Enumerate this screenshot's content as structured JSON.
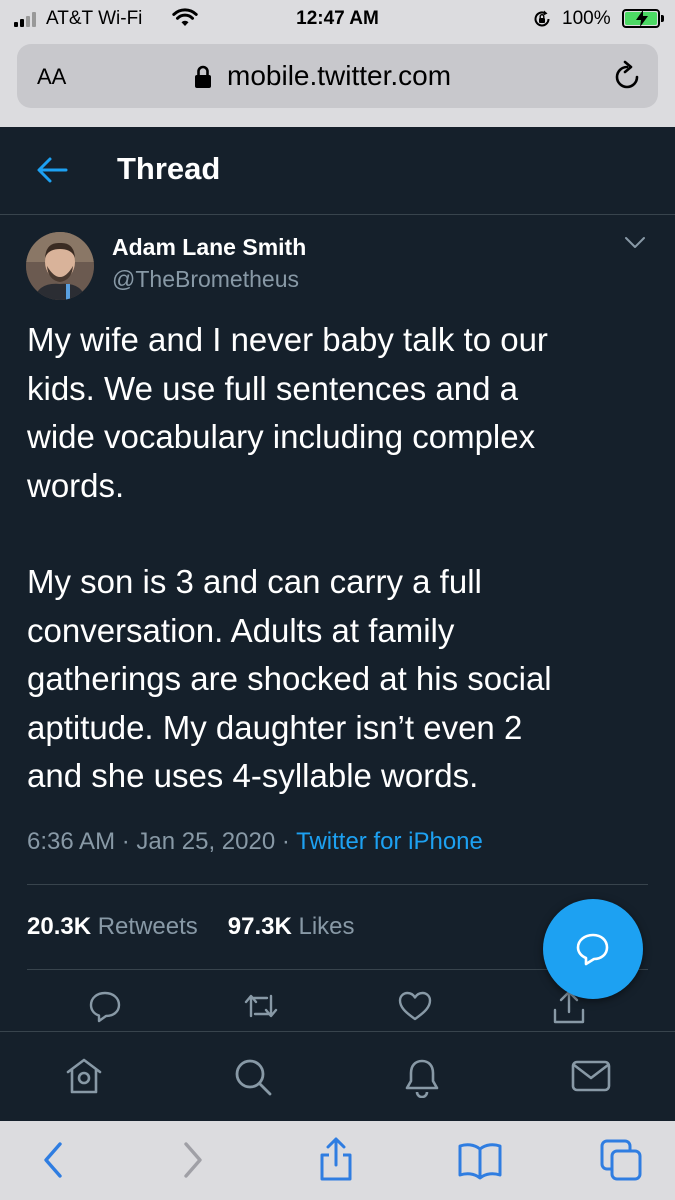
{
  "status_bar": {
    "carrier": "AT&T Wi-Fi",
    "time": "12:47 AM",
    "battery": "100%"
  },
  "browser": {
    "text_size_label": "AA",
    "url": "mobile.twitter.com"
  },
  "header": {
    "title": "Thread"
  },
  "tweet": {
    "author_name": "Adam Lane Smith",
    "author_handle": "@TheBrometheus",
    "paragraphs": [
      "My wife and I never baby talk to our\nkids. We use full sentences and a\nwide vocabulary including complex\nwords.",
      "My son is 3 and can carry a full\nconversation. Adults at family\ngatherings are shocked at his social\naptitude. My daughter isn’t even 2\nand she uses 4-syllable words."
    ],
    "time": "6:36 AM",
    "separator": "·",
    "date": "Jan 25, 2020",
    "client": "Twitter for iPhone",
    "retweets_count": "20.3K",
    "retweets_label": "Retweets",
    "likes_count": "97.3K",
    "likes_label": "Likes"
  },
  "colors": {
    "background": "#15202b",
    "accent": "#1da1f2",
    "secondary_text": "#8899a6",
    "divider": "#38444d"
  },
  "icons": {
    "header": [
      "back-arrow-icon"
    ],
    "tweet_actions": [
      "reply-icon",
      "retweet-icon",
      "like-icon",
      "share-icon"
    ],
    "bottom_nav": [
      "home-icon",
      "search-icon",
      "notifications-icon",
      "messages-icon"
    ],
    "safari_toolbar": [
      "back-icon",
      "forward-icon",
      "share-icon",
      "bookmarks-icon",
      "tabs-icon"
    ]
  }
}
